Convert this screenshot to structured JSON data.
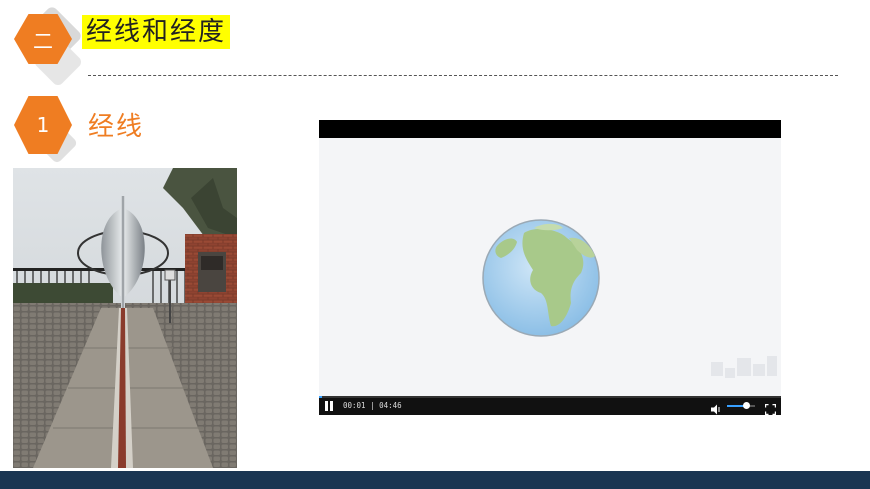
{
  "section": {
    "number": "二",
    "title": "经线和经度"
  },
  "subsection": {
    "number": "1",
    "title": "经线"
  },
  "photo": {
    "icon": "meridian-monument-photo"
  },
  "video": {
    "current_time": "00:01",
    "duration": "04:46",
    "time_text": "00:01 | 04:46",
    "progress_fraction": 0.004,
    "volume_fraction": 0.7,
    "play_state_icon": "pause-icon",
    "colors": {
      "accent": "#38a0ff",
      "bar": "#111111"
    }
  },
  "colors": {
    "orange": "#ef7d22",
    "highlight": "#ffff00",
    "footer": "#1a3552"
  }
}
